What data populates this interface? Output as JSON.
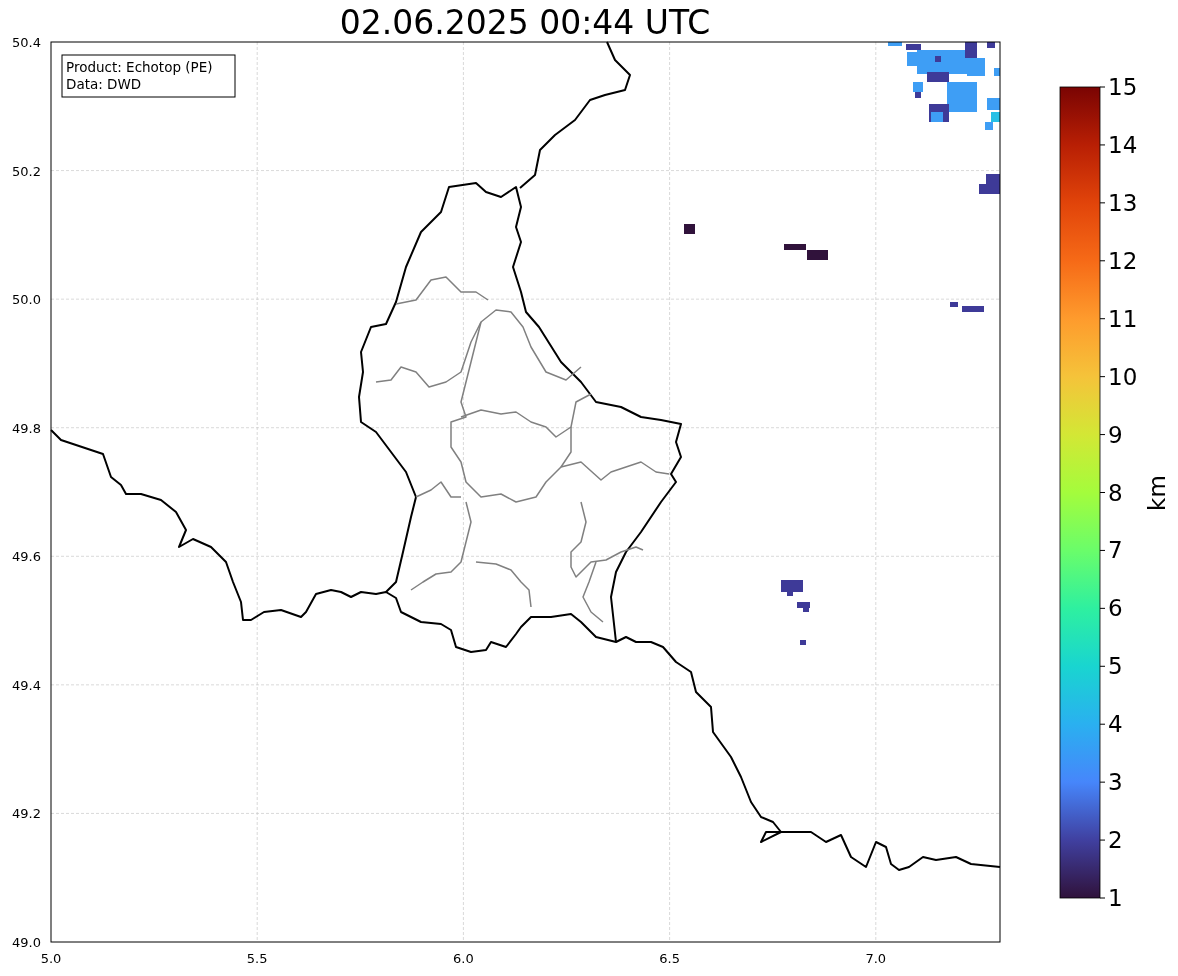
{
  "chart": {
    "title": "02.06.2025 00:44 UTC",
    "legend_lines": [
      "Product: Echotop (PE)",
      "Data: DWD"
    ],
    "xticks": [
      "5.0",
      "5.5",
      "6.0",
      "6.5",
      "7.0"
    ],
    "yticks": [
      "50.4",
      "50.2",
      "50.0",
      "49.8",
      "49.6",
      "49.4",
      "49.2",
      "49.0"
    ]
  },
  "colorbar": {
    "label": "km",
    "ticks": [
      "15",
      "14",
      "13",
      "12",
      "11",
      "10",
      "9",
      "8",
      "7",
      "6",
      "5",
      "4",
      "3",
      "2",
      "1"
    ]
  }
}
